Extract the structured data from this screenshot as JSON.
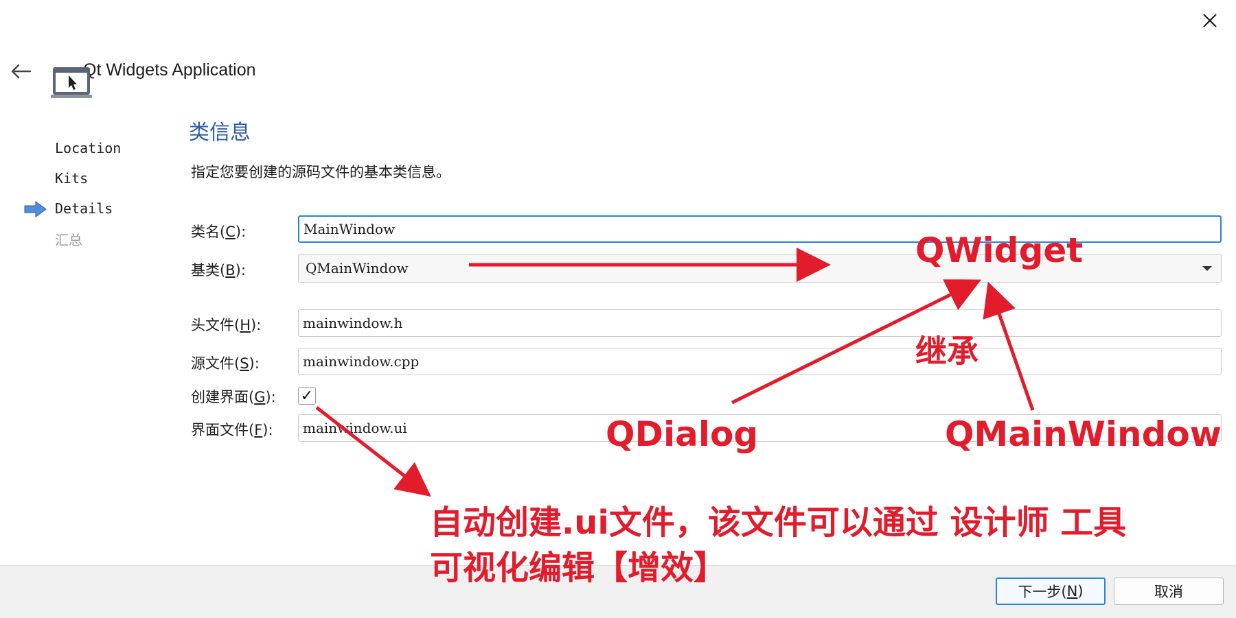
{
  "window": {
    "title": "Qt Widgets Application",
    "close_icon": "close-icon",
    "back_icon": "back-arrow-icon"
  },
  "sidebar": {
    "items": [
      {
        "label": "Location",
        "state": "done"
      },
      {
        "label": "Kits",
        "state": "done"
      },
      {
        "label": "Details",
        "state": "current"
      },
      {
        "label": "汇总",
        "state": "pending"
      }
    ]
  },
  "page": {
    "title": "类信息",
    "description": "指定您要创建的源码文件的基本类信息。"
  },
  "form": {
    "class_name": {
      "label_prefix": "类名(",
      "mnemonic": "C",
      "label_suffix": "):",
      "value": "MainWindow"
    },
    "base_class": {
      "label_prefix": "基类(",
      "mnemonic": "B",
      "label_suffix": "):",
      "value": "QMainWindow"
    },
    "header_file": {
      "label_prefix": "头文件(",
      "mnemonic": "H",
      "label_suffix": "):",
      "value": "mainwindow.h"
    },
    "source_file": {
      "label_prefix": "源文件(",
      "mnemonic": "S",
      "label_suffix": "):",
      "value": "mainwindow.cpp"
    },
    "create_form": {
      "label_prefix": "创建界面(",
      "mnemonic": "G",
      "label_suffix": "):",
      "checked": true,
      "check_glyph": "✓"
    },
    "form_file": {
      "label_prefix": "界面文件(",
      "mnemonic": "F",
      "label_suffix": "):",
      "value": "mainwindow.ui"
    }
  },
  "footer": {
    "next_prefix": "下一步(",
    "next_mnemonic": "N",
    "next_suffix": ")",
    "cancel_label": "取消"
  },
  "annotations": {
    "color": "#e31c2c",
    "qwidget": "QWidget",
    "inherit": "继承",
    "qdialog": "QDialog",
    "qmainwindow": "QMainWindow",
    "note_line1": "自动创建.ui文件，该文件可以通过 设计师 工具",
    "note_line2": "可视化编辑【增效】"
  },
  "colors": {
    "accent": "#2a83d8",
    "section_title": "#2a5db0",
    "footer_bg": "#f0f0f0"
  }
}
